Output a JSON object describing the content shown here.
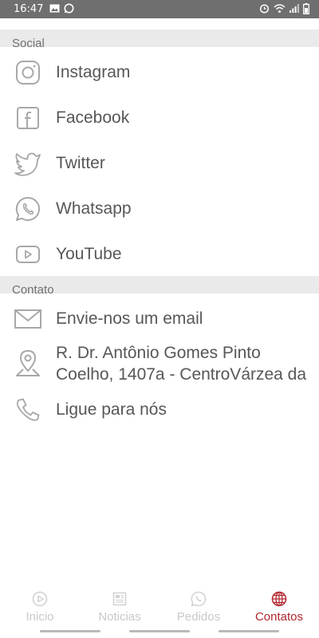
{
  "status_bar": {
    "time": "16:47",
    "left_icons": [
      "image-icon",
      "whatsapp-notification-icon"
    ],
    "right_icons": [
      "alarm-icon",
      "wifi-icon",
      "signal-icon",
      "battery-icon"
    ]
  },
  "social": {
    "header": "Social",
    "items": [
      {
        "label": "Instagram",
        "icon": "instagram-icon"
      },
      {
        "label": "Facebook",
        "icon": "facebook-icon"
      },
      {
        "label": "Twitter",
        "icon": "twitter-icon"
      },
      {
        "label": "Whatsapp",
        "icon": "whatsapp-icon"
      },
      {
        "label": "YouTube",
        "icon": "youtube-icon"
      }
    ]
  },
  "contato": {
    "header": "Contato",
    "email": {
      "label": "Envie-nos um email",
      "icon": "mail-icon"
    },
    "address": {
      "line1": "R. Dr. Antônio Gomes Pinto",
      "line2": "Coelho, 1407a - CentroVárzea da",
      "icon": "location-pin-icon"
    },
    "phone": {
      "label": "Ligue para nós",
      "icon": "phone-icon"
    }
  },
  "bottom_nav": {
    "items": [
      {
        "label": "Inicio",
        "icon": "play-circle-icon",
        "active": false
      },
      {
        "label": "Noticias",
        "icon": "newspaper-icon",
        "active": false
      },
      {
        "label": "Pedidos",
        "icon": "whatsapp-icon",
        "active": false
      },
      {
        "label": "Contatos",
        "icon": "globe-icon",
        "active": true
      }
    ]
  },
  "colors": {
    "accent": "#b3262d",
    "status_bar": "#6f6f6f",
    "section_header": "#eaeaea",
    "text": "#575757",
    "icon": "#a8a8a8",
    "inactive_nav": "#c9c9c9"
  }
}
